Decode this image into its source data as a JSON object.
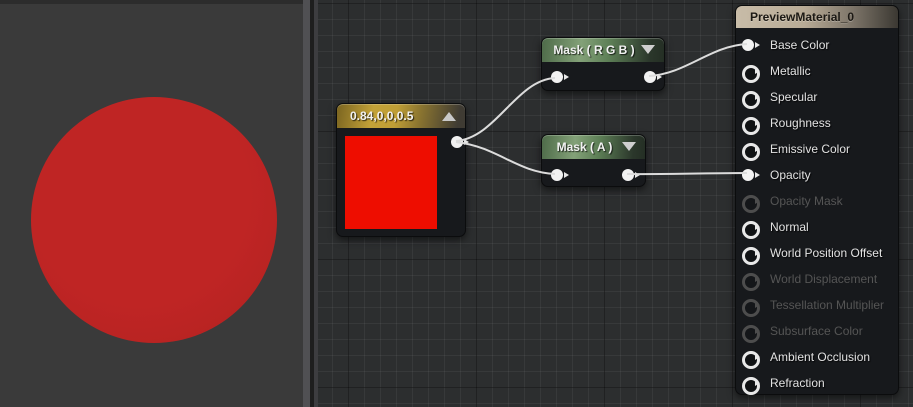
{
  "preview_panel": {
    "background_color": "#3a3a3a",
    "sphere": {
      "color": "#bf2524",
      "description": "red translucent preview sphere"
    }
  },
  "graph_panel": {
    "background_color": "#2c2e2f",
    "wire_color": "#dcdcdc",
    "nodes": {
      "constant": {
        "title": "0.84,0,0,0.5",
        "collapse_icon": "triangle-up-icon",
        "header_color": "#c3a238",
        "swatch_color": "#ee0d00",
        "output_pin": {
          "state": "connected"
        }
      },
      "mask_rgb": {
        "title": "Mask ( R G B )",
        "collapse_icon": "triangle-down-icon",
        "header_color": "#5d7f56",
        "input_pin": {
          "state": "connected"
        },
        "output_pin": {
          "state": "connected"
        }
      },
      "mask_a": {
        "title": "Mask ( A )",
        "collapse_icon": "triangle-down-icon",
        "header_color": "#5d7f56",
        "input_pin": {
          "state": "connected"
        },
        "output_pin": {
          "state": "connected"
        }
      },
      "material": {
        "title": "PreviewMaterial_0",
        "header_color": "#bdb09c",
        "inputs": [
          {
            "label": "Base Color",
            "state": "connected"
          },
          {
            "label": "Metallic",
            "state": "enabled"
          },
          {
            "label": "Specular",
            "state": "enabled"
          },
          {
            "label": "Roughness",
            "state": "enabled"
          },
          {
            "label": "Emissive Color",
            "state": "enabled"
          },
          {
            "label": "Opacity",
            "state": "connected"
          },
          {
            "label": "Opacity Mask",
            "state": "disabled"
          },
          {
            "label": "Normal",
            "state": "enabled"
          },
          {
            "label": "World Position Offset",
            "state": "enabled"
          },
          {
            "label": "World Displacement",
            "state": "disabled"
          },
          {
            "label": "Tessellation Multiplier",
            "state": "disabled"
          },
          {
            "label": "Subsurface Color",
            "state": "disabled"
          },
          {
            "label": "Ambient Occlusion",
            "state": "enabled"
          },
          {
            "label": "Refraction",
            "state": "enabled"
          }
        ]
      }
    },
    "connections": [
      {
        "from": "constant.output",
        "to": "mask_rgb.input"
      },
      {
        "from": "constant.output",
        "to": "mask_a.input"
      },
      {
        "from": "mask_rgb.output",
        "to": "material.Base Color"
      },
      {
        "from": "mask_a.output",
        "to": "material.Opacity"
      }
    ]
  }
}
